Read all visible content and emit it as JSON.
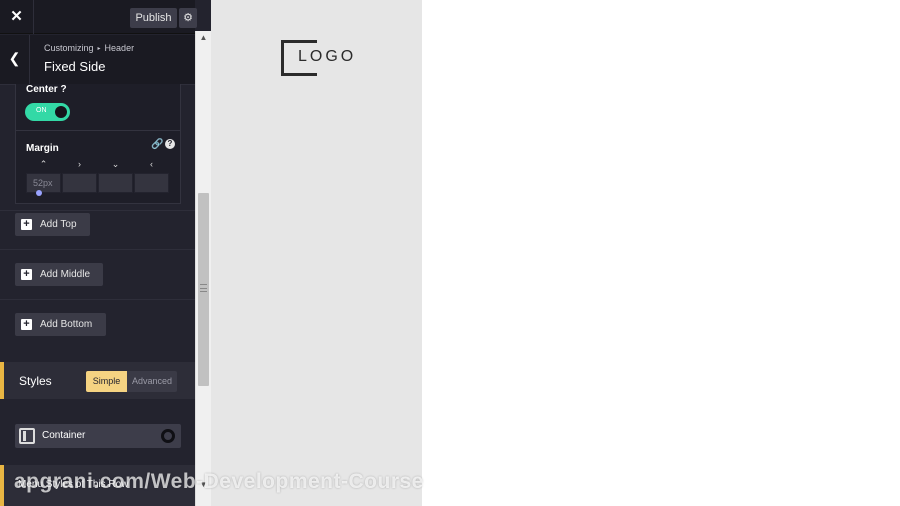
{
  "topbar": {
    "close_label": "✕",
    "publish_label": "Publish",
    "settings_icon": "⚙"
  },
  "panel": {
    "back_icon": "❮",
    "breadcrumb_root": "Customizing",
    "breadcrumb_sep": "▸",
    "breadcrumb_section": "Header",
    "title": "Fixed Side"
  },
  "options": {
    "center_label": "Center ?",
    "toggle_text": "ON",
    "toggle_on": true,
    "margin_label": "Margin",
    "link_icon": "🔗",
    "help_icon": "?",
    "arrows": [
      "⌃",
      "›",
      "⌄",
      "‹"
    ],
    "margin_values": [
      "52px",
      "",
      "",
      ""
    ]
  },
  "buttons": {
    "add_top": "Add Top",
    "add_middle": "Add Middle",
    "add_bottom": "Add Bottom",
    "plus_icon": "+"
  },
  "styles": {
    "label": "Styles",
    "simple": "Simple",
    "advanced": "Advanced",
    "active": "Simple"
  },
  "container": {
    "label": "Container",
    "enabled": false
  },
  "menu_row": {
    "label": "Menu Styles of This Row"
  },
  "scrollbar": {
    "up_icon": "▲",
    "down_icon": "▼"
  },
  "preview": {
    "logo_text": "LOGO"
  },
  "watermark": "apgrani.com/Web-Development-Course",
  "colors": {
    "accent": "#e9b643",
    "toggle_on": "#33d9a6",
    "sidebar_bg": "#23232e",
    "preview_bg": "#e6e6e6"
  }
}
